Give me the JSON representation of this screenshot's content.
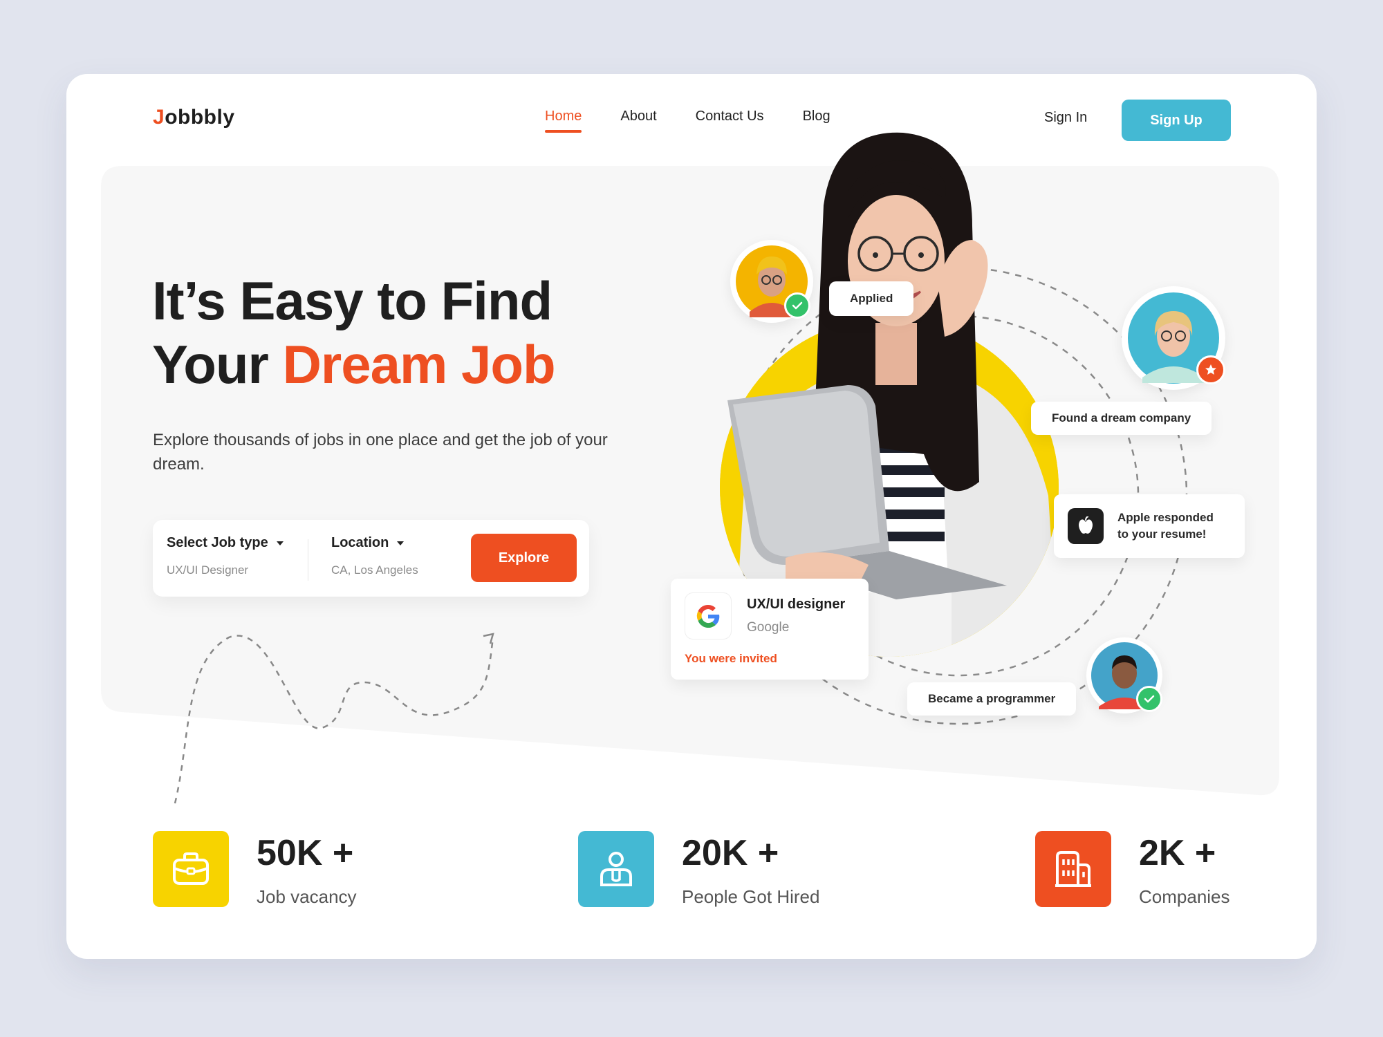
{
  "brand": {
    "initial": "J",
    "rest": "obbbly"
  },
  "nav": {
    "items": [
      {
        "label": "Home",
        "active": true
      },
      {
        "label": "About",
        "active": false
      },
      {
        "label": "Contact Us",
        "active": false
      },
      {
        "label": "Blog",
        "active": false
      }
    ],
    "signin_label": "Sign In",
    "signup_label": "Sign Up"
  },
  "hero": {
    "title_line1": "It’s Easy to Find",
    "title_line2_prefix": "Your ",
    "title_line2_accent": "Dream Job",
    "subtitle": "Explore thousands of jobs in one place and get the job of your dream."
  },
  "search": {
    "job_type_label": "Select Job type",
    "job_type_value": "UX/UI Designer",
    "location_label": "Location",
    "location_value": "CA, Los Angeles",
    "explore_label": "Explore"
  },
  "floating": {
    "applied": "Applied",
    "found_company": "Found a dream company",
    "apple_line1": "Apple responded",
    "apple_line2": "to your resume!",
    "job_title": "UX/UI designer",
    "job_company": "Google",
    "job_status": "You were invited",
    "programmer": "Became a programmer"
  },
  "stats": [
    {
      "value": "50K +",
      "label": "Job vacancy",
      "icon": "briefcase-icon",
      "color": "#f7d300"
    },
    {
      "value": "20K +",
      "label": "People Got Hired",
      "icon": "person-badge-icon",
      "color": "#44b9d3"
    },
    {
      "value": "2K +",
      "label": "Companies",
      "icon": "building-icon",
      "color": "#ee4f21"
    }
  ],
  "colors": {
    "accent": "#ee4f21",
    "teal": "#44b9d3",
    "yellow": "#f7d300",
    "success": "#33c26a"
  }
}
